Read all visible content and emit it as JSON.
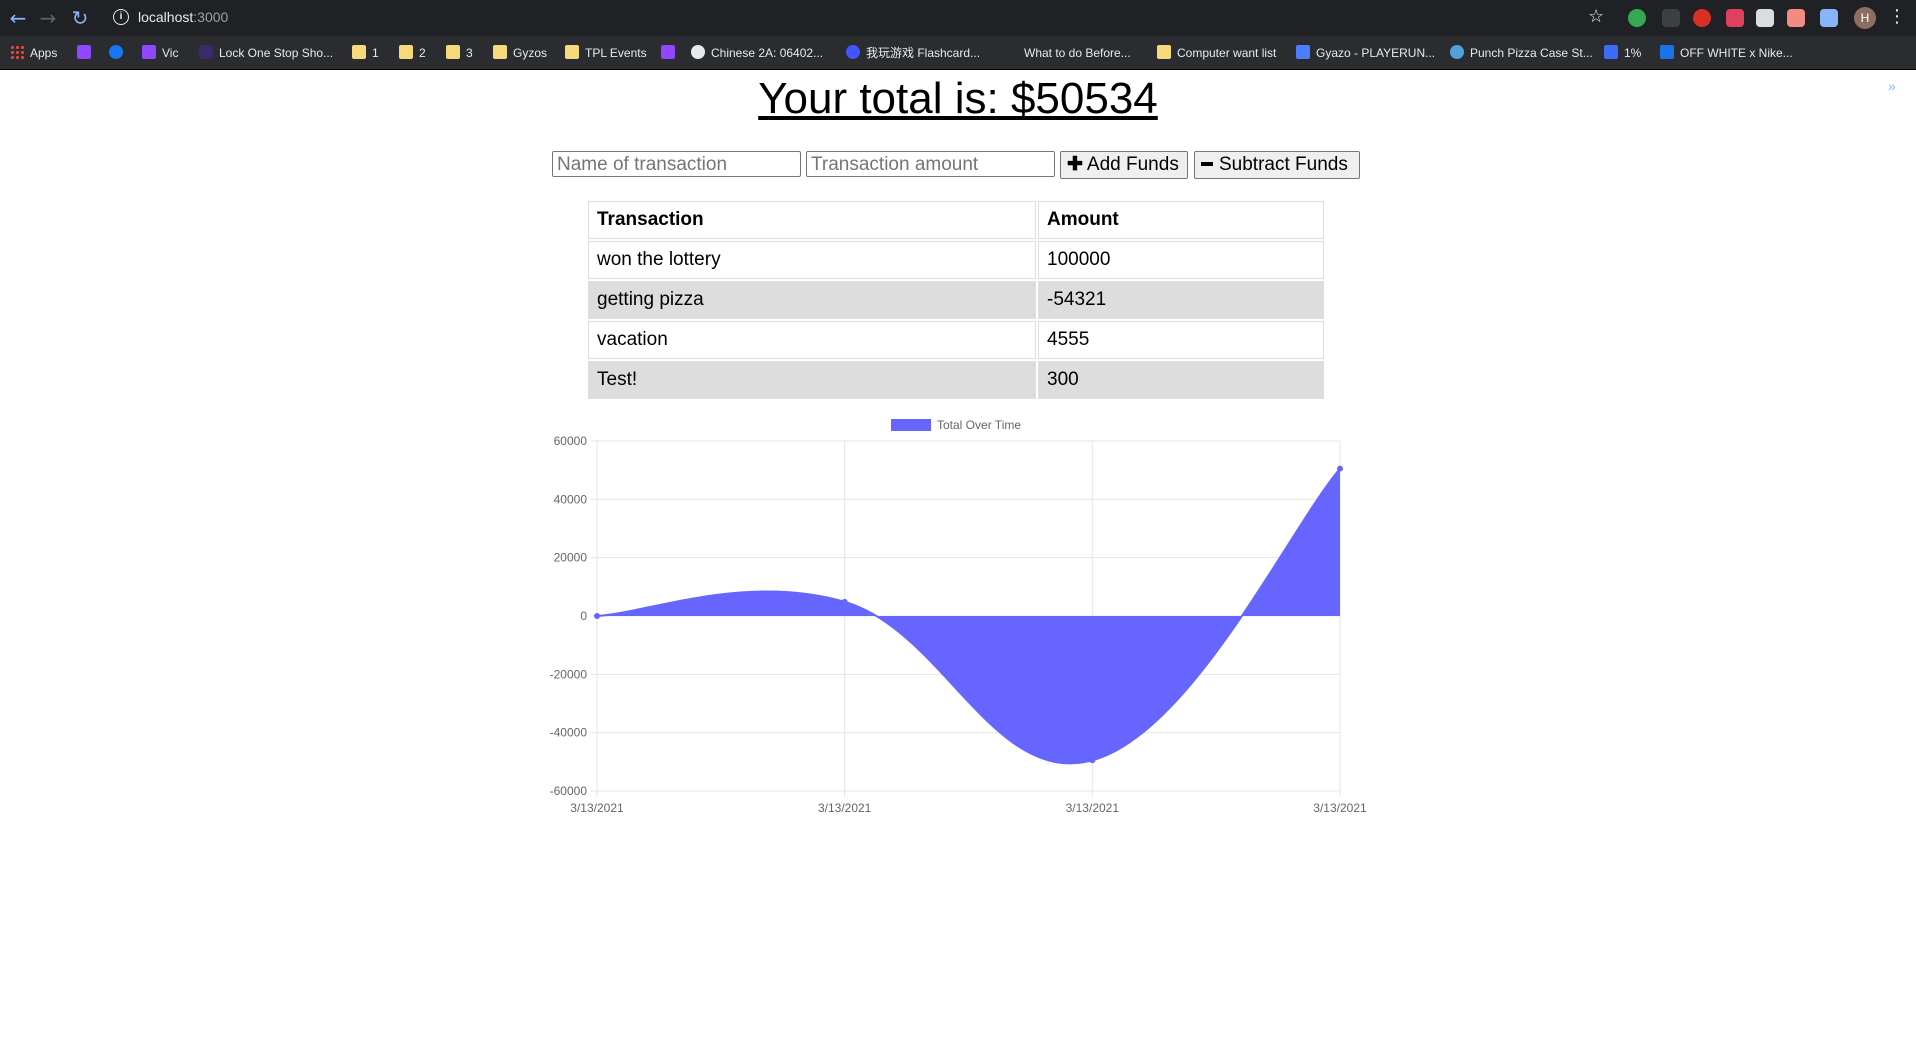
{
  "browser": {
    "url_host": "localhost",
    "url_port": ":3000",
    "bookmarks": [
      {
        "label": "Apps",
        "icon": "apps-grid-icon"
      },
      {
        "label": "",
        "icon": "twitch-icon"
      },
      {
        "label": "",
        "icon": "facebook-icon"
      },
      {
        "label": "Vic",
        "icon": "twitch-icon"
      },
      {
        "label": "Lock One Stop Sho...",
        "icon": "site-icon"
      },
      {
        "label": "1",
        "icon": "folder-icon"
      },
      {
        "label": "2",
        "icon": "folder-icon"
      },
      {
        "label": "3",
        "icon": "folder-icon"
      },
      {
        "label": "Gyzos",
        "icon": "folder-icon"
      },
      {
        "label": "TPL Events",
        "icon": "folder-icon"
      },
      {
        "label": "",
        "icon": "twitch-icon"
      },
      {
        "label": "Chinese 2A: 06402...",
        "icon": "skype-icon"
      },
      {
        "label": "我玩游戏 Flashcard...",
        "icon": "quizlet-icon"
      },
      {
        "label": "What to do Before...",
        "icon": "site-icon"
      },
      {
        "label": "Computer want list",
        "icon": "folder-icon"
      },
      {
        "label": "Gyazo - PLAYERUN...",
        "icon": "gyazo-icon"
      },
      {
        "label": "Punch Pizza Case St...",
        "icon": "site-icon"
      },
      {
        "label": "1%",
        "icon": "site-icon"
      },
      {
        "label": "OFF WHITE x Nike...",
        "icon": "site-icon"
      }
    ],
    "avatar_letter": "H",
    "colors": {
      "chrome_bg": "#202124",
      "bookmark_bg": "#2b2c2f",
      "accent": "#8ab4f8"
    }
  },
  "page": {
    "total_text": "Your total is: $50534",
    "form": {
      "name_placeholder": "Name of transaction",
      "amount_placeholder": "Transaction amount",
      "add_label": "Add Funds",
      "subtract_label": "Subtract Funds"
    },
    "table": {
      "headers": [
        "Transaction",
        "Amount"
      ],
      "rows": [
        {
          "name": "won the lottery",
          "amount": "100000"
        },
        {
          "name": "getting pizza",
          "amount": "-54321"
        },
        {
          "name": "vacation",
          "amount": "4555"
        },
        {
          "name": "Test!",
          "amount": "300"
        }
      ]
    }
  },
  "chart_data": {
    "type": "area",
    "x": [
      "3/13/2021",
      "3/13/2021",
      "3/13/2021",
      "3/13/2021"
    ],
    "series": [
      {
        "name": "Total Over Time",
        "values": [
          0,
          4855,
          -49466,
          50534
        ]
      }
    ],
    "ylim": [
      -60000,
      60000
    ],
    "yticks": [
      "60000",
      "40000",
      "20000",
      "0",
      "-20000",
      "-40000",
      "-60000"
    ],
    "legend": "top-center",
    "grid": true,
    "fill_color": "#6666ff"
  }
}
